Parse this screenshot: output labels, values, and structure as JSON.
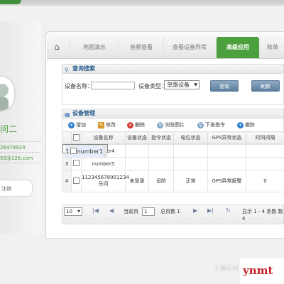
{
  "nav": {
    "home_icon": "home-icon",
    "tabs": [
      {
        "label": "地图演示",
        "active": false
      },
      {
        "label": "音频查看",
        "active": false
      },
      {
        "label": "查看设备异常",
        "active": false
      },
      {
        "label": "高级应用",
        "active": true
      },
      {
        "label": "账单",
        "active": false
      }
    ]
  },
  "user": {
    "name": "问二",
    "phone": "26478924",
    "email": "55@126.com",
    "button_label": "注销"
  },
  "query": {
    "header": "查询搜索",
    "device_name_label": "设备名称：",
    "device_name_value": "",
    "device_type_label": "设备类型：",
    "device_type_value": "单路设备",
    "search_button": "查询",
    "refresh_button": "刷新"
  },
  "device_mgmt": {
    "header": "设备管理",
    "toolbar": {
      "add": "增加",
      "edit": "修改",
      "delete": "删除",
      "browse_images": "浏览图片",
      "send_command": "下发指令",
      "remove": "撤防"
    },
    "columns": [
      "设备名称",
      "设备状态",
      "指令状态",
      "电位状态",
      "GPS异常状态",
      "时间间隔"
    ],
    "rows": [
      {
        "num": "1",
        "name": "number1",
        "status": "",
        "cmd": "",
        "potential": "",
        "gps": "",
        "interval": ""
      },
      {
        "num": "2",
        "name": "number4",
        "status": "",
        "cmd": "",
        "potential": "",
        "gps": "",
        "interval": ""
      },
      {
        "num": "3",
        "name": "number5",
        "status": "",
        "cmd": "",
        "potential": "",
        "gps": "",
        "interval": ""
      },
      {
        "num": "4",
        "name": "112345678901234 乐问",
        "status": "未登录",
        "cmd": "设防",
        "potential": "正常",
        "gps": "GPS异常报警",
        "interval": "0"
      }
    ]
  },
  "pager": {
    "page_size": "10",
    "current_page_label": "当前页",
    "current_page": "1",
    "total_pages": "总页数 1",
    "info": "显示 1 - 4 条数 数 4"
  },
  "watermark": {
    "company": "上海乐问",
    "site": "ynmt"
  },
  "colors": {
    "accent_green": "#4c9f3d",
    "header_blue": "#2b5f91",
    "selected_row": "#e6eefb"
  }
}
